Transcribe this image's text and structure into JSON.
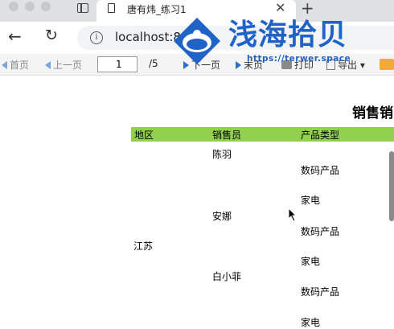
{
  "browser": {
    "tab_title": "唐有炜_练习1",
    "tab_close": "✕",
    "new_tab": "+",
    "url": "localhost:8080",
    "back_icon": "←",
    "reload_icon": "↻"
  },
  "watermark": {
    "text": "浅海拾贝",
    "url": "https://terwer.space"
  },
  "toolbar": {
    "first": "首页",
    "prev": "上一页",
    "page_value": "1",
    "page_total": "/5",
    "next": "下一页",
    "last": "末页",
    "print": "打印",
    "export": "导出",
    "export_arrow": "▾"
  },
  "report": {
    "title": "销售销",
    "columns": [
      "地区",
      "销售员",
      "产品类型"
    ],
    "region": "江苏",
    "salespeople": [
      "陈羽",
      "安娜",
      "白小菲"
    ],
    "product_types": [
      "数码产品",
      "家电",
      "数码产品",
      "家电",
      "数码产品",
      "家电"
    ]
  }
}
